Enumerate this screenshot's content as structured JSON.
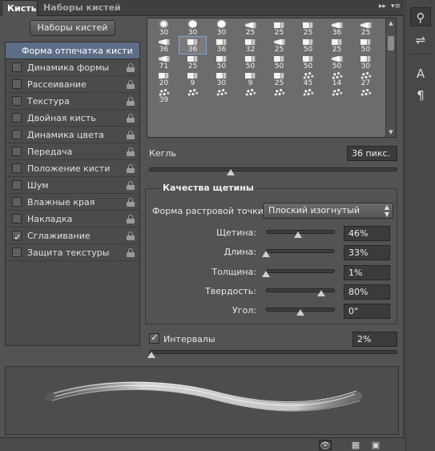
{
  "tabs": [
    {
      "label": "Кисть",
      "active": true
    },
    {
      "label": "Наборы кистей",
      "active": false
    }
  ],
  "tab_icons": [
    "collapse-icon",
    "panel-menu-icon"
  ],
  "presets_button": "Наборы кистей",
  "left_list": {
    "header": "Форма отпечатка кисти",
    "items": [
      {
        "label": "Динамика формы",
        "checked": false,
        "lock": true
      },
      {
        "label": "Рассеивание",
        "checked": false,
        "lock": true
      },
      {
        "label": "Текстура",
        "checked": false,
        "lock": true
      },
      {
        "label": "Двойная кисть",
        "checked": false,
        "lock": true
      },
      {
        "label": "Динамика цвета",
        "checked": false,
        "lock": true
      },
      {
        "label": "Передача",
        "checked": false,
        "lock": true
      },
      {
        "label": "Положение кисти",
        "checked": false,
        "lock": true
      },
      {
        "label": "Шум",
        "checked": false,
        "lock": true
      },
      {
        "label": "Влажные края",
        "checked": false,
        "lock": true
      },
      {
        "label": "Накладка",
        "checked": false,
        "lock": true
      },
      {
        "label": "Сглаживание",
        "checked": true,
        "lock": true
      },
      {
        "label": "Защита текстуры",
        "checked": false,
        "lock": true
      }
    ]
  },
  "brush_tiles": [
    {
      "n": "30",
      "s": "soft"
    },
    {
      "n": "30",
      "s": "round"
    },
    {
      "n": "30",
      "s": "round"
    },
    {
      "n": "25",
      "s": "fan"
    },
    {
      "n": "25",
      "s": "flat"
    },
    {
      "n": "25",
      "s": "flat"
    },
    {
      "n": "36",
      "s": "fan"
    },
    {
      "n": "25",
      "s": "fan"
    },
    {
      "n": "36",
      "s": "fan"
    },
    {
      "n": "36",
      "s": "flat"
    },
    {
      "n": "36",
      "s": "flat"
    },
    {
      "n": "32",
      "s": "flat"
    },
    {
      "n": "25",
      "s": "fan"
    },
    {
      "n": "50",
      "s": "flat"
    },
    {
      "n": "25",
      "s": "flat"
    },
    {
      "n": "50",
      "s": "flat"
    },
    {
      "n": "71",
      "s": "fan"
    },
    {
      "n": "25",
      "s": "flat"
    },
    {
      "n": "50",
      "s": "flat"
    },
    {
      "n": "50",
      "s": "flat"
    },
    {
      "n": "50",
      "s": "flat"
    },
    {
      "n": "50",
      "s": "flat"
    },
    {
      "n": "50",
      "s": "fan"
    },
    {
      "n": "30",
      "s": "flat"
    },
    {
      "n": "20",
      "s": "flat"
    },
    {
      "n": "9",
      "s": "flat"
    },
    {
      "n": "30",
      "s": "flat"
    },
    {
      "n": "9",
      "s": "flat"
    },
    {
      "n": "25",
      "s": "flat"
    },
    {
      "n": "45",
      "s": "splat"
    },
    {
      "n": "14",
      "s": "splat"
    },
    {
      "n": "27",
      "s": "splat"
    },
    {
      "n": "39",
      "s": "splat"
    },
    {
      "n": "",
      "s": "splat"
    },
    {
      "n": "",
      "s": "splat"
    },
    {
      "n": "",
      "s": "splat"
    },
    {
      "n": "",
      "s": "splat"
    },
    {
      "n": "",
      "s": "splat"
    },
    {
      "n": "",
      "s": "splat"
    },
    {
      "n": "",
      "s": "splat"
    }
  ],
  "selected_tile": 9,
  "size": {
    "label": "Кегль",
    "value": "36 пикс.",
    "fraction": 0.33
  },
  "bristle": {
    "title": "Качества щетины",
    "shape_label": "Форма растровой точки:",
    "shape_value": "Плоский изогнутый",
    "params": [
      {
        "label": "Щетина:",
        "value": "46%",
        "fraction": 0.46
      },
      {
        "label": "Длина:",
        "value": "33%",
        "fraction": 0.0
      },
      {
        "label": "Толщина:",
        "value": "1%",
        "fraction": 0.0
      },
      {
        "label": "Твердость:",
        "value": "80%",
        "fraction": 0.8
      },
      {
        "label": "Угол:",
        "value": "0°",
        "fraction": 0.5
      }
    ]
  },
  "spacing": {
    "label": "Интервалы",
    "checked": true,
    "value": "2%",
    "fraction": 0.0
  },
  "bottom_icons": [
    "brush-preview-icon",
    "grid-view-icon",
    "new-brush-icon"
  ],
  "right_bar_icons": [
    "brush-panel-icon",
    "adjust-panel-icon",
    "character-panel-icon",
    "paragraph-panel-icon"
  ]
}
